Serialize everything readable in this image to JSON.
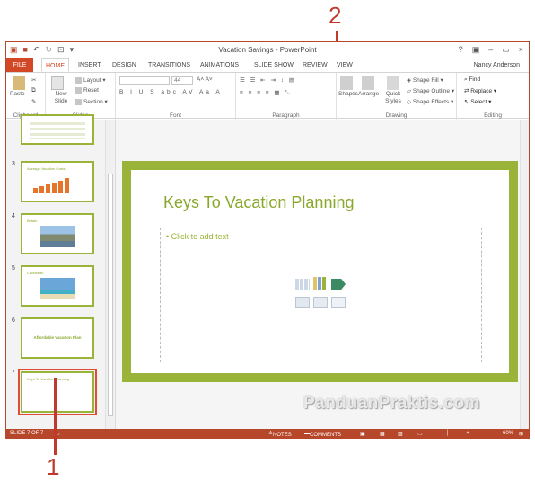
{
  "window": {
    "title": "Vacation Savings - PowerPoint",
    "controls": [
      "?",
      "▣",
      "–",
      "▭",
      "×"
    ]
  },
  "tabs": {
    "items": [
      "FILE",
      "HOME",
      "INSERT",
      "DESIGN",
      "TRANSITIONS",
      "ANIMATIONS",
      "SLIDE SHOW",
      "REVIEW",
      "VIEW"
    ],
    "active": "HOME",
    "user": "Nancy Anderson"
  },
  "ribbon": {
    "clipboard": {
      "label": "Clipboard",
      "paste": "Paste"
    },
    "slides": {
      "label": "Slides",
      "new_slide": "New Slide",
      "layout": "Layout",
      "reset": "Reset",
      "section": "Section"
    },
    "font": {
      "label": "Font",
      "size": "44"
    },
    "paragraph": {
      "label": "Paragraph"
    },
    "drawing": {
      "label": "Drawing",
      "shapes": "Shapes",
      "arrange": "Arrange",
      "quick_styles": "Quick Styles",
      "shape_fill": "Shape Fill",
      "shape_outline": "Shape Outline",
      "shape_effects": "Shape Effects"
    },
    "editing": {
      "label": "Editing",
      "find": "Find",
      "replace": "Replace",
      "select": "Select"
    }
  },
  "thumbnails": [
    {
      "num": "",
      "title": ""
    },
    {
      "num": "3",
      "title": "Average Vacation Costs"
    },
    {
      "num": "4",
      "title": "Britain"
    },
    {
      "num": "5",
      "title": "Caribbean"
    },
    {
      "num": "6",
      "title": "Affordable Vacation Plan"
    },
    {
      "num": "7",
      "title": "Keys To Vacation Planning"
    }
  ],
  "slide": {
    "title": "Keys To Vacation Planning",
    "placeholder": "Click to add text"
  },
  "status": {
    "slide_indicator": "SLIDE 7 OF 7",
    "notes": "NOTES",
    "comments": "COMMENTS",
    "zoom": "60%"
  },
  "callouts": {
    "one": "1",
    "two": "2"
  },
  "watermark": "PanduanPraktis.com",
  "colors": {
    "accent": "#b7472a",
    "slide_green": "#9ab43a",
    "callout": "#c0392b"
  }
}
